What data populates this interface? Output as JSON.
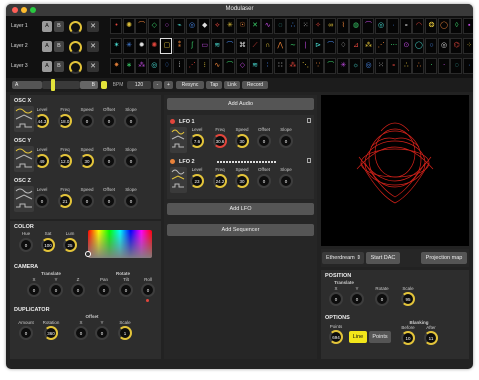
{
  "app": {
    "title": "Modulaser"
  },
  "colors": {
    "accent_yellow": "#e3c43a",
    "accent_red": "#e2463c",
    "accent_orange": "#e8823a",
    "panel_bg": "#2d2d2d"
  },
  "layers": [
    {
      "label": "Layer 1",
      "a": "A",
      "b": "B"
    },
    {
      "label": "Layer 2",
      "a": "A",
      "b": "B"
    },
    {
      "label": "Layer 3",
      "a": "A",
      "b": "B"
    }
  ],
  "control_bar": {
    "a_label": "A",
    "b_label": "B",
    "bpm_label": "BPM",
    "bpm_value": "120",
    "minus_label": "-",
    "plus_label": "+",
    "resync_label": "Resync",
    "tap_label": "Tap",
    "link_label": "Link",
    "record_label": "Record"
  },
  "osc": {
    "columns": [
      "Level",
      "Freq",
      "Speed",
      "Offset",
      "Slope"
    ],
    "x": {
      "title": "OSC X",
      "values": [
        "44.3",
        "18.0",
        "0",
        "0",
        "0"
      ]
    },
    "y": {
      "title": "OSC Y",
      "values": [
        "49",
        "12.0",
        "30",
        "0",
        "0"
      ]
    },
    "z": {
      "title": "OSC Z",
      "values": [
        "0",
        "21",
        "0",
        "0",
        "0"
      ]
    }
  },
  "color": {
    "title": "COLOR",
    "hue_label": "Hue",
    "sat_label": "Sat",
    "lum_label": "Lum",
    "hue": "0",
    "sat": "100",
    "lum": "25"
  },
  "camera": {
    "title": "CAMERA",
    "translate_label": "Translate",
    "rotate_label": "Rotate",
    "x_label": "X",
    "y_label": "Y",
    "z_label": "Z",
    "pan_label": "Pan",
    "tilt_label": "Tilt",
    "roll_label": "Roll",
    "values": [
      "0",
      "0",
      "0",
      "0",
      "0",
      "0"
    ]
  },
  "duplicator": {
    "title": "DUPLICATOR",
    "amount_label": "Amount",
    "rotation_label": "Rotation",
    "offset_label": "Offset",
    "x_label": "X",
    "y_label": "Y",
    "scale_label": "Scale",
    "values": [
      "0",
      "360",
      "0",
      "0",
      "1"
    ]
  },
  "middle": {
    "add_audio": "Add Audio",
    "add_lfo": "Add LFO",
    "add_sequencer": "Add Sequencer",
    "lfo_columns": [
      "Level",
      "Freq",
      "Speed",
      "Offset",
      "Slope"
    ],
    "lfo1": {
      "title": "LFO 1",
      "values": [
        "7.6",
        "30.6",
        "30",
        "0",
        "0"
      ]
    },
    "lfo2": {
      "title": "LFO 2",
      "values": [
        "23",
        "24.2",
        "30",
        "0",
        "0"
      ]
    }
  },
  "output": {
    "dac_name": "Etherdream",
    "start_dac": "Start DAC",
    "projection_map": "Projection map"
  },
  "position": {
    "title": "POSITION",
    "translate_label": "Translate",
    "x_label": "X",
    "y_label": "Y",
    "rotate_label": "Rotate",
    "scale_label": "Scale",
    "values": [
      "0",
      "0",
      "0",
      "95"
    ]
  },
  "options": {
    "title": "OPTIONS",
    "points_label": "Points",
    "points_value": "694",
    "line_label": "Line",
    "points_toggle": "Points",
    "blanking_label": "Blanking",
    "before_label": "Before",
    "after_label": "After",
    "before_value": "10",
    "after_value": "11"
  }
}
